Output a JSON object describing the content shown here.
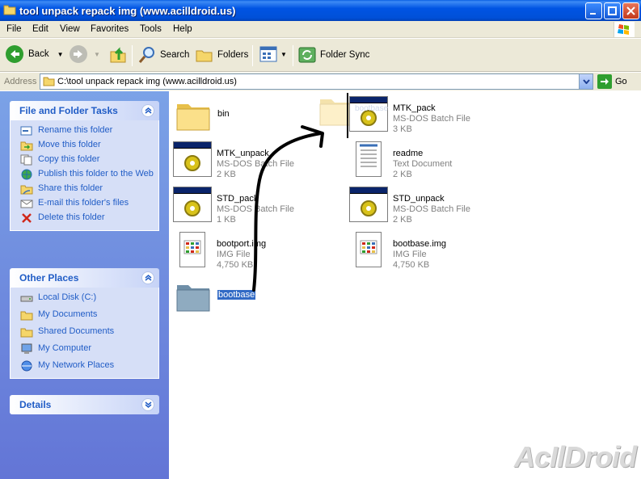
{
  "window": {
    "title": "tool unpack repack img (www.acilldroid.us)"
  },
  "menu": {
    "items": [
      "File",
      "Edit",
      "View",
      "Favorites",
      "Tools",
      "Help"
    ]
  },
  "toolbar": {
    "back_label": "Back",
    "search_label": "Search",
    "folders_label": "Folders",
    "folder_sync_label": "Folder Sync"
  },
  "address": {
    "label": "Address",
    "value": "C:\\tool unpack repack img (www.acilldroid.us)",
    "go_label": "Go"
  },
  "tasks": {
    "title": "File and Folder Tasks",
    "items": [
      {
        "label": "Rename this folder",
        "icon": "rename-icon"
      },
      {
        "label": "Move this folder",
        "icon": "move-icon"
      },
      {
        "label": "Copy this folder",
        "icon": "copy-icon"
      },
      {
        "label": "Publish this folder to the Web",
        "icon": "globe-icon"
      },
      {
        "label": "Share this folder",
        "icon": "share-icon"
      },
      {
        "label": "E-mail this folder's files",
        "icon": "email-icon"
      },
      {
        "label": "Delete this folder",
        "icon": "delete-icon"
      }
    ]
  },
  "other_places": {
    "title": "Other Places",
    "items": [
      {
        "label": "Local Disk (C:)",
        "icon": "drive-icon"
      },
      {
        "label": "My Documents",
        "icon": "folder-icon"
      },
      {
        "label": "Shared Documents",
        "icon": "folder-icon"
      },
      {
        "label": "My Computer",
        "icon": "computer-icon"
      },
      {
        "label": "My Network Places",
        "icon": "network-icon"
      }
    ]
  },
  "details": {
    "title": "Details"
  },
  "files": {
    "bin": {
      "name": "bin"
    },
    "mtk_pack": {
      "name": "MTK_pack",
      "type": "MS-DOS Batch File",
      "size": "3 KB"
    },
    "drag_ghost": {
      "name": "bootbase"
    },
    "mtk_unpack": {
      "name": "MTK_unpack",
      "type": "MS-DOS Batch File",
      "size": "2 KB"
    },
    "readme": {
      "name": "readme",
      "type": "Text Document",
      "size": "2 KB"
    },
    "std_pack": {
      "name": "STD_pack",
      "type": "MS-DOS Batch File",
      "size": "1 KB"
    },
    "std_unpack": {
      "name": "STD_unpack",
      "type": "MS-DOS Batch File",
      "size": "2 KB"
    },
    "bootport": {
      "name": "bootport.img",
      "type": "IMG File",
      "size": "4,750 KB"
    },
    "bootbase_img": {
      "name": "bootbase.img",
      "type": "IMG File",
      "size": "4,750 KB"
    },
    "bootbase_folder": {
      "name": "bootbase"
    }
  },
  "watermark": "AcIlDroid",
  "colors": {
    "titlebar": "#0054e3",
    "taskpane": "#6375d6",
    "link": "#215dc6",
    "selection": "#316ac5"
  }
}
